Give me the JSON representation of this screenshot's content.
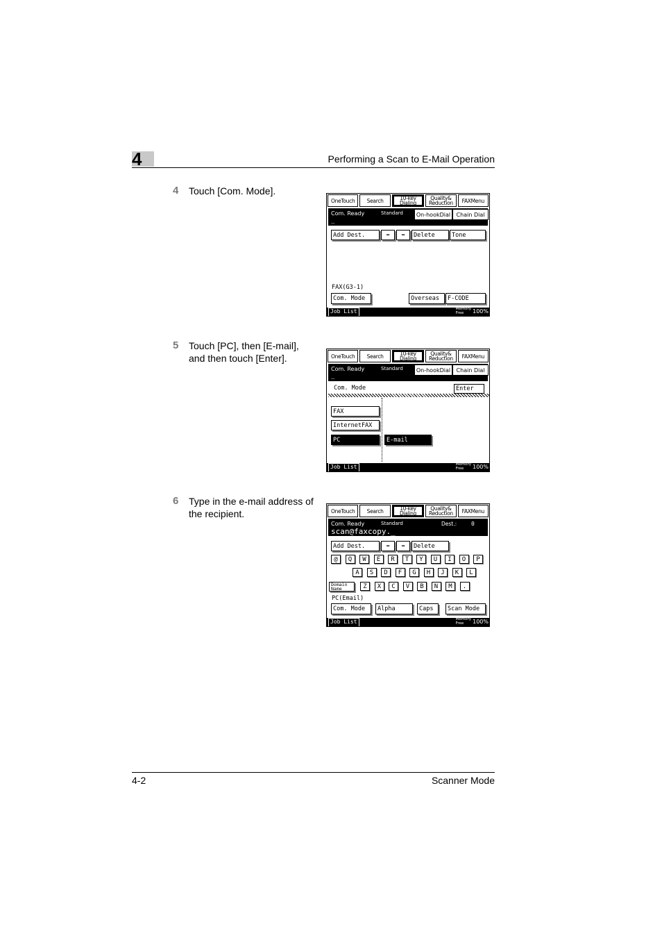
{
  "header": {
    "chapter": "4",
    "title": "Performing a Scan to E-Mail Operation"
  },
  "footer": {
    "page": "4-2",
    "section": "Scanner Mode"
  },
  "steps": [
    {
      "num": "4",
      "text": "Touch [Com. Mode]."
    },
    {
      "num": "5",
      "text": "Touch [PC], then [E-mail], and then touch [Enter]."
    },
    {
      "num": "6",
      "text": "Type in the e-mail address of the recipient."
    }
  ],
  "screen_common": {
    "tabs": [
      "OneTouch",
      "Search",
      "10-key Dialing",
      "Quality& Reduction",
      "FAXMenu"
    ],
    "status": "Com. Ready",
    "standard": "Standard",
    "on_hook": "On-hookDial",
    "chain_dial": "Chain Dial",
    "job_list": "Job List",
    "memory": "Memory",
    "free": "Free",
    "memory_pct": "100%"
  },
  "screen1": {
    "add_dest": "Add Dest.",
    "delete": "Delete",
    "tone": "Tone",
    "mode_label": "FAX(G3-1)",
    "com_mode": "Com. Mode",
    "overseas": "Overseas",
    "fcode": "F-CODE"
  },
  "screen2": {
    "com_mode": "Com. Mode",
    "enter": "Enter",
    "options": [
      "FAX",
      "InternetFAX",
      "PC"
    ],
    "email": "E-mail"
  },
  "screen3": {
    "address": "scan@faxcopy._",
    "dest_label": "Dest.:",
    "dest_count": "0",
    "add_dest": "Add Dest.",
    "delete": "Delete",
    "row1": [
      "@",
      "Q",
      "W",
      "E",
      "R",
      "T",
      "Y",
      "U",
      "I",
      "O",
      "P"
    ],
    "row2": [
      "A",
      "S",
      "D",
      "F",
      "G",
      "H",
      "J",
      "K",
      "L"
    ],
    "domain": "Domain Name",
    "row3": [
      "Z",
      "X",
      "C",
      "V",
      "B",
      "N",
      "M",
      "."
    ],
    "mode_label": "PC(Email)",
    "com_mode": "Com. Mode",
    "alpha": "Alpha",
    "caps": "Caps",
    "scan_mode": "Scan Mode"
  }
}
